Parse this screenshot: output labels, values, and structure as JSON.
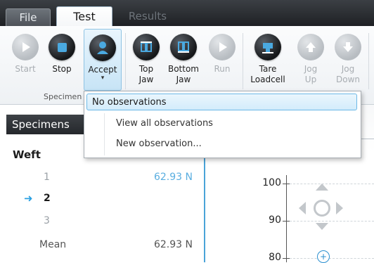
{
  "tabs": [
    {
      "label": "File"
    },
    {
      "label": "Test"
    },
    {
      "label": "Results"
    }
  ],
  "ribbon": {
    "buttons": [
      {
        "label": "Start",
        "label2": "",
        "icon": "play-icon",
        "enabled": false
      },
      {
        "label": "Stop",
        "label2": "",
        "icon": "stop-icon",
        "enabled": true
      },
      {
        "label": "Accept",
        "label2": "",
        "icon": "accept-person-icon",
        "enabled": true,
        "active": true
      },
      {
        "label": "Top",
        "label2": "Jaw",
        "icon": "top-jaw-icon",
        "enabled": true
      },
      {
        "label": "Bottom",
        "label2": "Jaw",
        "icon": "bottom-jaw-icon",
        "enabled": true
      },
      {
        "label": "Run",
        "label2": "",
        "icon": "run-icon",
        "enabled": false
      },
      {
        "label": "Tare",
        "label2": "Loadcell",
        "icon": "tare-loadcell-icon",
        "enabled": true
      },
      {
        "label": "Jog",
        "label2": "Up",
        "icon": "jog-up-icon",
        "enabled": false
      },
      {
        "label": "Jog",
        "label2": "Down",
        "icon": "jog-down-icon",
        "enabled": false
      }
    ],
    "group_label": "Specimen"
  },
  "dropdown": {
    "items": [
      {
        "label": "No observations",
        "selected": true
      },
      {
        "label": "View all observations",
        "selected": false
      },
      {
        "label": "New observation...",
        "selected": false
      }
    ]
  },
  "specimens": {
    "title": "Specimens",
    "group": "Weft",
    "rows": [
      {
        "num": "1",
        "value": "62.93 N"
      },
      {
        "num": "2",
        "value": ""
      },
      {
        "num": "3",
        "value": ""
      }
    ],
    "mean_label": "Mean",
    "mean_value": "62.93 N"
  },
  "chart": {
    "ticks": [
      "100",
      "90",
      "80"
    ]
  },
  "colors": {
    "accent": "#4aa3d8",
    "value_text": "#5aaee0",
    "tab_bar": "#2a2d31"
  }
}
